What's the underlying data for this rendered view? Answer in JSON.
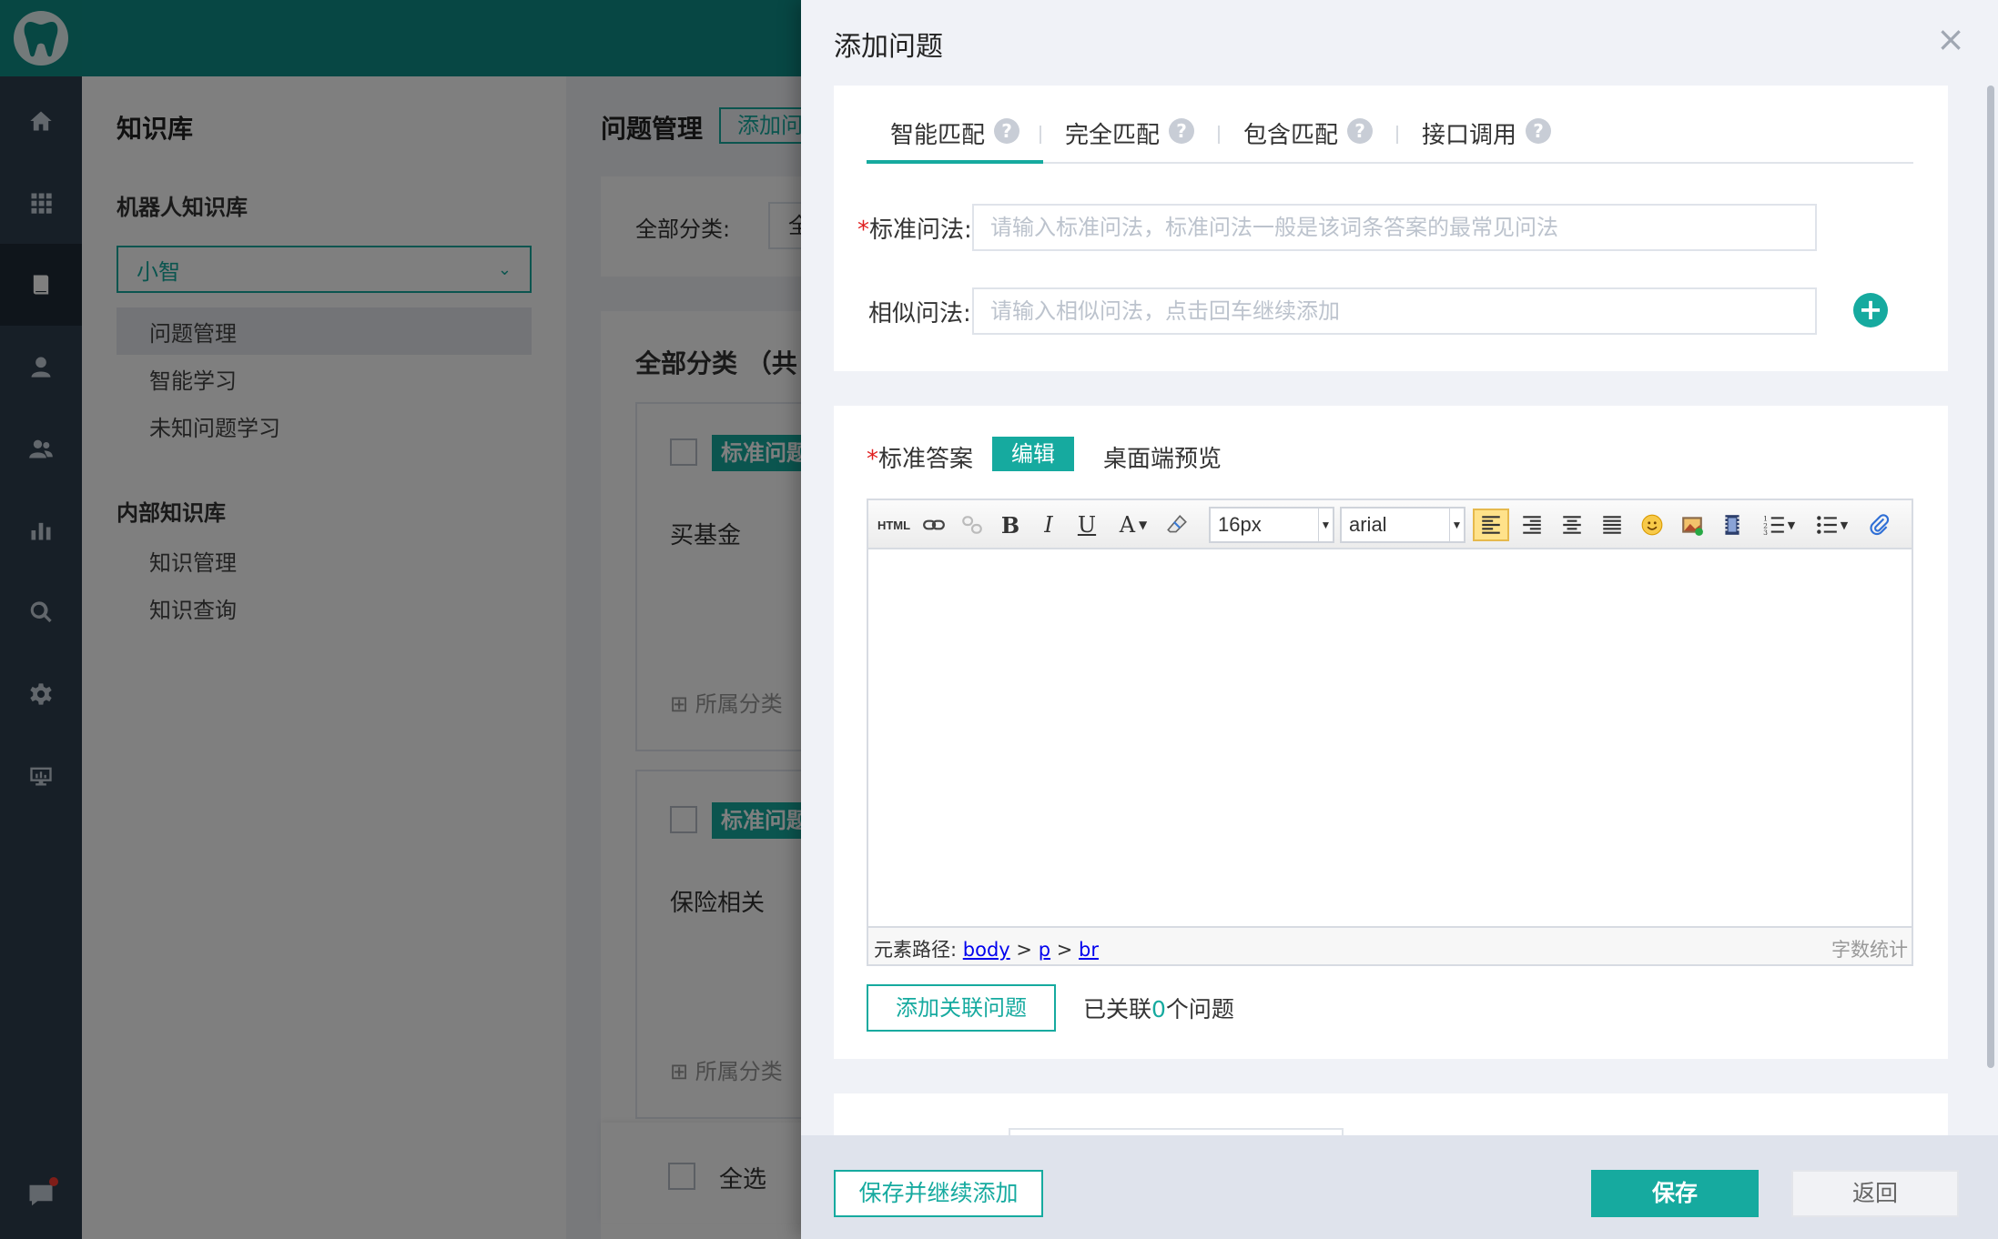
{
  "sidebar_rail": {
    "icons": [
      "tooth-logo-icon",
      "home-icon",
      "grid-icon",
      "book-icon",
      "user-icon",
      "users-icon",
      "bar-chart-icon",
      "search-icon",
      "gear-icon",
      "monitor-icon",
      "chat-icon"
    ]
  },
  "knowledge_sidebar": {
    "title": "知识库",
    "robot_section": "机器人知识库",
    "robot_select": "小智",
    "robot_items": [
      "问题管理",
      "智能学习",
      "未知问题学习"
    ],
    "internal_section": "内部知识库",
    "internal_items": [
      "知识管理",
      "知识查询"
    ]
  },
  "main": {
    "title": "问题管理",
    "add_button": "添加问题",
    "filter_label": "全部分类:",
    "filter_value": "全部",
    "list_header": "全部分类 （共",
    "cards": [
      {
        "tag": "标准问题",
        "question": "买基金",
        "category_label": "所属分类"
      },
      {
        "tag": "标准问题",
        "question": "保险相关",
        "category_label": "所属分类"
      }
    ],
    "select_all": "全选"
  },
  "drawer": {
    "title": "添加问题",
    "close_label": "×",
    "tabs": [
      {
        "label": "智能匹配",
        "active": true
      },
      {
        "label": "完全匹配",
        "active": false
      },
      {
        "label": "包含匹配",
        "active": false
      },
      {
        "label": "接口调用",
        "active": false
      }
    ],
    "help_mark": "?",
    "std_question_label": "标准问法:",
    "std_question_required": "*",
    "std_question_placeholder": "请输入标准问法，标准问法一般是该词条答案的最常见问法",
    "similar_label": "相似问法:",
    "similar_placeholder": "请输入相似问法，点击回车继续添加",
    "add_similar": "+",
    "answer_label": "标准答案",
    "answer_required": "*",
    "edit_tab": "编辑",
    "preview_tab": "桌面端预览",
    "editor": {
      "html_label": "HTML",
      "bold": "B",
      "italic": "I",
      "underline": "U",
      "font_color": "A",
      "font_size": "16px",
      "font_family": "arial",
      "path_label": "元素路径:",
      "path": [
        "body",
        "p",
        "br"
      ],
      "path_sep": ">",
      "word_count": "字数统计"
    },
    "related_button": "添加关联问题",
    "related_prefix": "已关联",
    "related_count": "0",
    "related_suffix": "个问题",
    "save_continue": "保存并继续添加",
    "save": "保存",
    "back": "返回"
  },
  "colors": {
    "accent": "#16aa9f",
    "rail": "#2f3f4e",
    "required": "#e02020"
  }
}
